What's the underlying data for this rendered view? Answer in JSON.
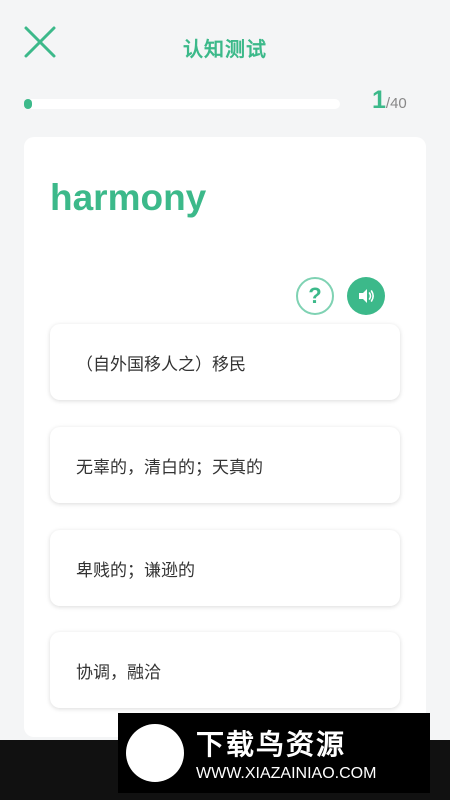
{
  "header": {
    "title": "认知测试"
  },
  "progress": {
    "current": "1",
    "separator": "/",
    "total": "40",
    "fraction": 0.025
  },
  "quiz": {
    "word": "harmony",
    "help_label": "?",
    "options": [
      "（自外国移人之）移民",
      "无辜的，清白的；天真的",
      "卑贱的；谦逊的",
      "协调，融洽"
    ]
  },
  "watermark": {
    "brand": "下载鸟资源",
    "url": "WWW.XIAZAINIAO.COM"
  },
  "colors": {
    "accent": "#3cb98a",
    "background": "#f4f5f6"
  },
  "icons": {
    "close": "close-icon",
    "sound": "speaker-icon",
    "help": "question-icon"
  }
}
